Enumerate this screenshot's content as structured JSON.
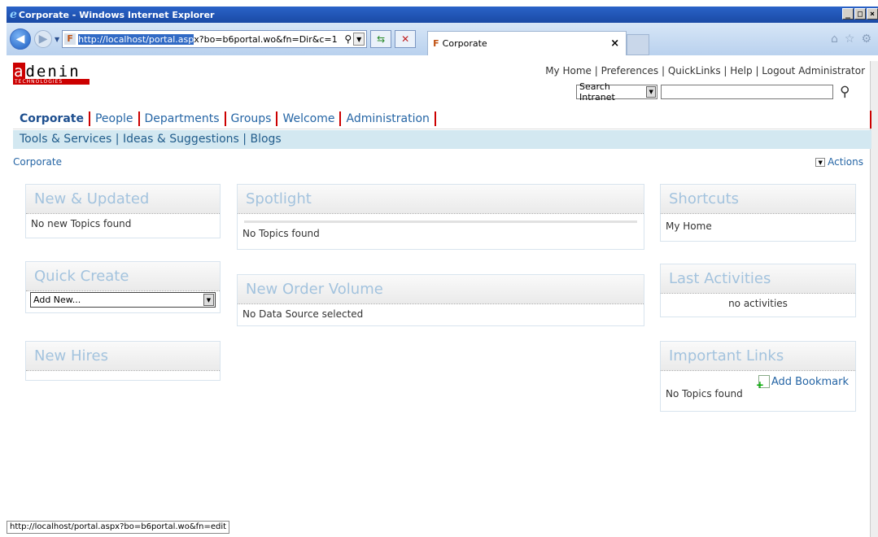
{
  "window": {
    "title": "Corporate - Windows Internet Explorer"
  },
  "browser": {
    "address": {
      "highlighted": "http://localhost/portal.asp",
      "rest": "x?bo=b6portal.wo&fn=Dir&c=1"
    },
    "tab_title": "Corporate"
  },
  "header": {
    "logo_top": "adenin",
    "logo_bottom": "TECHNOLOGIES",
    "links": [
      "My Home",
      "Preferences",
      "QuickLinks",
      "Help",
      "Logout Administrator"
    ],
    "search_scope": "Search Intranet",
    "search_value": ""
  },
  "tabs": [
    "Corporate",
    "People",
    "Departments",
    "Groups",
    "Welcome",
    "Administration"
  ],
  "subnav": [
    "Tools & Services",
    "Ideas & Suggestions",
    "Blogs"
  ],
  "breadcrumb": "Corporate",
  "actions_label": "Actions",
  "portlets": {
    "new_updated": {
      "title": "New & Updated",
      "body": "No new Topics found"
    },
    "quick_create": {
      "title": "Quick Create",
      "select": "Add New..."
    },
    "new_hires": {
      "title": "New Hires"
    },
    "spotlight": {
      "title": "Spotlight",
      "body": "No Topics found"
    },
    "order_volume": {
      "title": "New Order Volume",
      "body": "No Data Source selected"
    },
    "shortcuts": {
      "title": "Shortcuts",
      "link": "My Home"
    },
    "last_activities": {
      "title": "Last Activities",
      "body": "no activities"
    },
    "important_links": {
      "title": "Important Links",
      "add": "Add Bookmark",
      "body": "No Topics found"
    }
  },
  "status_url": "http://localhost/portal.aspx?bo=b6portal.wo&fn=edit"
}
